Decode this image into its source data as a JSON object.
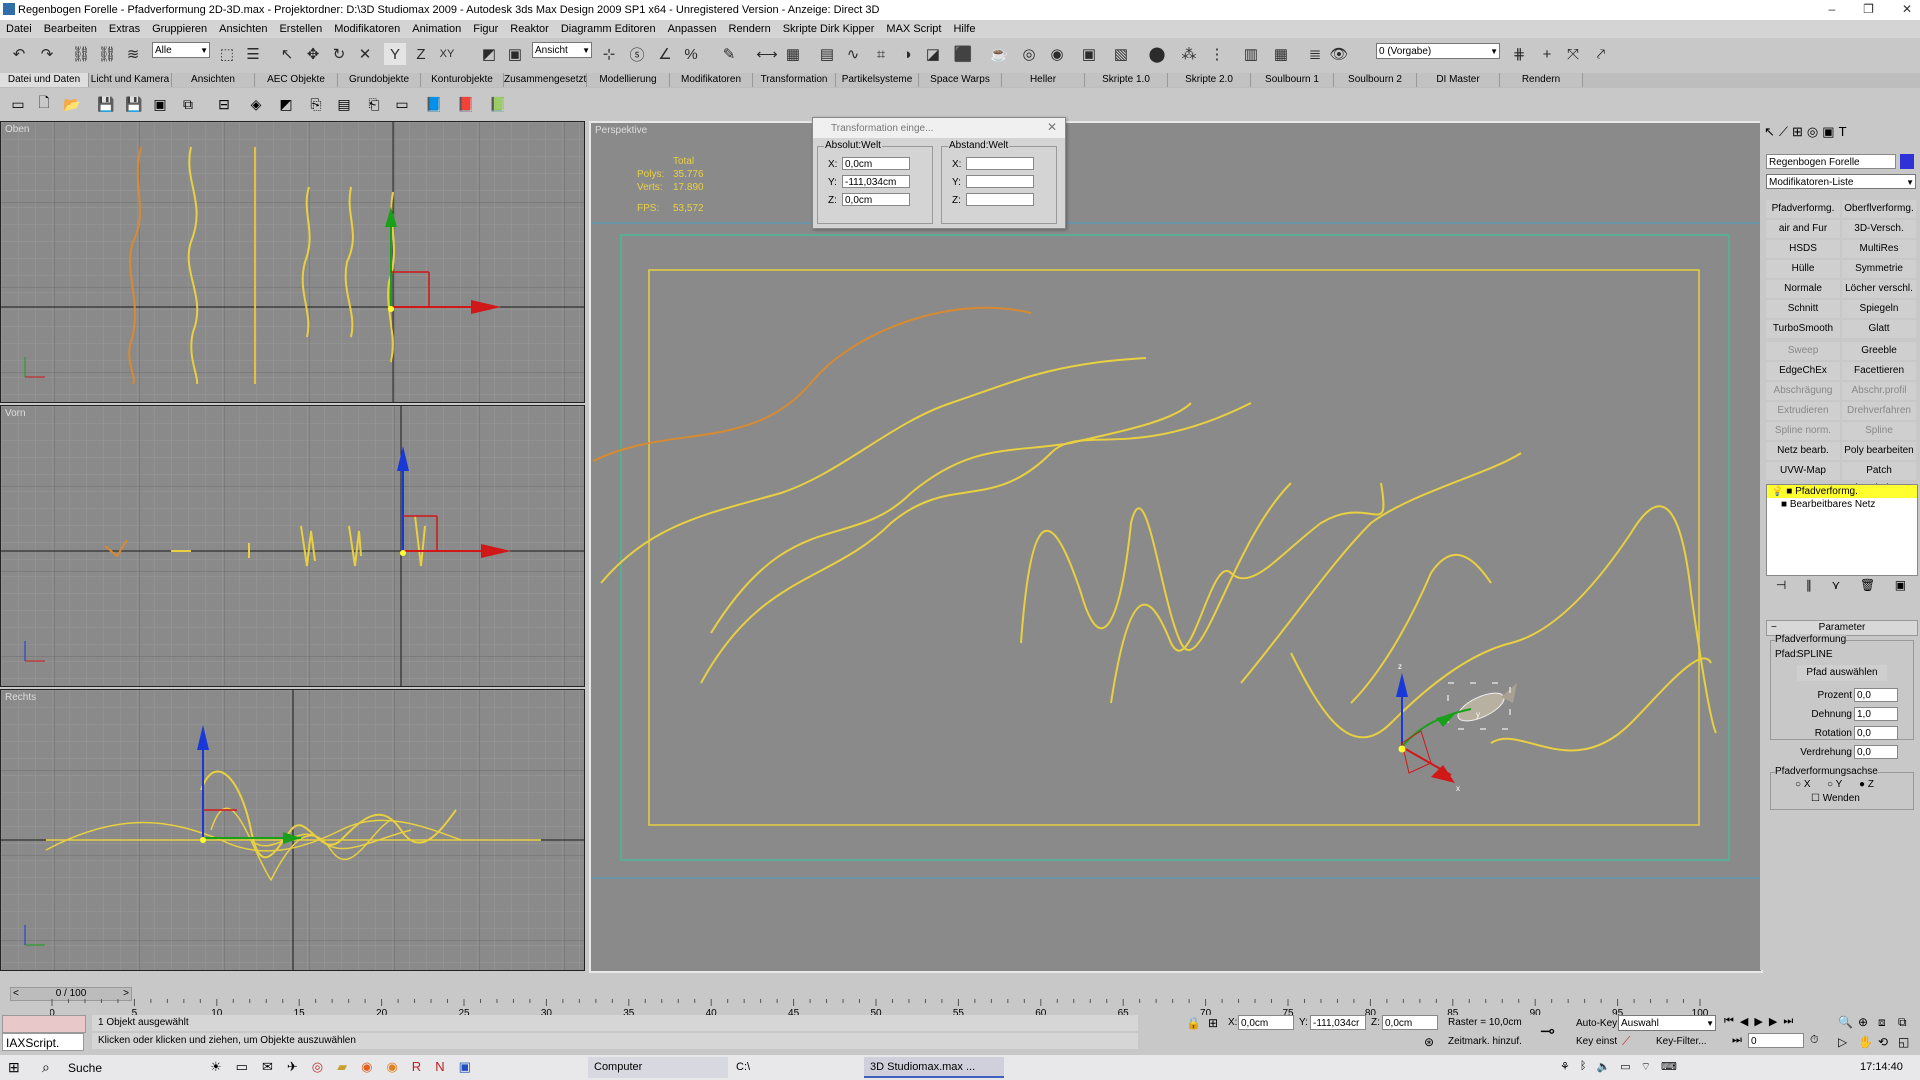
{
  "window": {
    "title": "Regenbogen Forelle - Pfadverformung 2D-3D.max     - Projektordner: D:\\3D Studiomax 2009     - Autodesk 3ds Max Design 2009 SP1  x64  - Unregistered Version     - Anzeige: Direct 3D",
    "controls": [
      "–",
      "❐",
      "✕"
    ]
  },
  "menu": [
    "Datei",
    "Bearbeiten",
    "Extras",
    "Gruppieren",
    "Ansichten",
    "Erstellen",
    "Modifikatoren",
    "Animation",
    "Figur",
    "Reaktor",
    "Diagramm Editoren",
    "Anpassen",
    "Rendern",
    "Skripte Dirk Kipper",
    "MAX Script",
    "Hilfe"
  ],
  "toolbar": {
    "selection_filter": "Alle",
    "coord_system": "Ansicht",
    "layer": "0 (Vorgabe)"
  },
  "tabs": [
    "Datei und Daten",
    "Licht und Kamera",
    "Ansichten",
    "AEC Objekte",
    "Grundobjekte",
    "Konturobjekte",
    "Zusammengesetzt",
    "Modellierung",
    "Modifikatoren",
    "Transformation",
    "Partikelsysteme",
    "Space Warps",
    "Heller",
    "Skripte 1.0",
    "Skripte 2.0",
    "Soulbourn 1",
    "Soulbourn 2",
    "DI Master",
    "Rendern"
  ],
  "viewports": {
    "top": "Oben",
    "front": "Vorn",
    "right": "Rechts",
    "perspective": "Perspektive"
  },
  "stats": {
    "total_label": "Total",
    "polys_label": "Polys:",
    "polys_value": "35.776",
    "verts_label": "Verts:",
    "verts_value": "17.890",
    "fps_label": "FPS:",
    "fps_value": "53,572"
  },
  "transform_dialog": {
    "title": "Transformation einge...",
    "absolute_group": "Absolut:Welt",
    "offset_group": "Abstand:Welt",
    "x_label": "X:",
    "y_label": "Y:",
    "z_label": "Z:",
    "abs_x": "0,0cm",
    "abs_y": "-111,034cm",
    "abs_z": "0,0cm"
  },
  "command_panel": {
    "object_name": "Regenbogen Forelle",
    "object_color": "#3030d8",
    "modifier_list": "Modifikatoren-Liste",
    "buttons": [
      {
        "label": "Pfadverformg.",
        "enabled": true
      },
      {
        "label": "Oberflverformg.",
        "enabled": true
      },
      {
        "label": "air and Fur (WKN",
        "enabled": true
      },
      {
        "label": "3D-Versch.",
        "enabled": true
      },
      {
        "label": "HSDS",
        "enabled": true
      },
      {
        "label": "MultiRes",
        "enabled": true
      },
      {
        "label": "Hülle",
        "enabled": true
      },
      {
        "label": "Symmetrie",
        "enabled": true
      },
      {
        "label": "Normale",
        "enabled": true
      },
      {
        "label": "Löcher verschl.",
        "enabled": true
      },
      {
        "label": "Schnitt",
        "enabled": true
      },
      {
        "label": "Spiegeln",
        "enabled": true
      },
      {
        "label": "TurboSmooth",
        "enabled": true
      },
      {
        "label": "Glatt",
        "enabled": true
      },
      {
        "label": "Sweep",
        "enabled": false
      },
      {
        "label": "Greeble",
        "enabled": true
      },
      {
        "label": "EdgeChEx",
        "enabled": true
      },
      {
        "label": "Facettieren",
        "enabled": true
      },
      {
        "label": "Abschrägung",
        "enabled": false
      },
      {
        "label": "Abschr.profil",
        "enabled": false
      },
      {
        "label": "Extrudieren",
        "enabled": false
      },
      {
        "label": "Drehverfahren",
        "enabled": false
      },
      {
        "label": "Spline norm.",
        "enabled": false
      },
      {
        "label": "Spline bearbeiten",
        "enabled": false
      },
      {
        "label": "Netz bearb.",
        "enabled": true
      },
      {
        "label": "Poly bearbeiten",
        "enabled": true
      },
      {
        "label": "UVW-Map",
        "enabled": true
      },
      {
        "label": "Patch bearbeiten",
        "enabled": true
      }
    ],
    "stack": [
      "Pfadverformg.",
      "Bearbeitbares Netz"
    ],
    "rollout_title": "Parameter",
    "group1": "Pfadverformung",
    "path_label": "Pfad:",
    "path_value": "SPLINE",
    "pick_path": "Pfad auswählen",
    "params": [
      {
        "label": "Prozent",
        "value": "0,0"
      },
      {
        "label": "Dehnung",
        "value": "1,0"
      },
      {
        "label": "Rotation",
        "value": "0,0"
      },
      {
        "label": "Verdrehung",
        "value": "0,0"
      }
    ],
    "axis_group": "Pfadverformungsachse",
    "axis_x": "X",
    "axis_y": "Y",
    "axis_z": "Z",
    "flip": "Wenden"
  },
  "timeline": {
    "frame": "0 / 100",
    "ticks": [
      "0",
      "5",
      "10",
      "15",
      "20",
      "25",
      "30",
      "35",
      "40",
      "45",
      "50",
      "55",
      "60",
      "65",
      "70",
      "75",
      "80",
      "85",
      "90",
      "95",
      "100"
    ]
  },
  "status": {
    "selected": "1 Objekt ausgewählt",
    "prompt": "Klicken oder klicken und ziehen, um Objekte auszuwählen",
    "maxscript": "IAXScript.",
    "x_label": "X:",
    "y_label": "Y:",
    "z_label": "Z:",
    "x": "0,0cm",
    "y": "-111,034cr",
    "z": "0,0cm",
    "grid": "Raster = 10,0cm",
    "timetag": "Zeitmark. hinzuf.",
    "autokey": "Auto-Key",
    "setkey": "Key einst",
    "selection": "Auswahl",
    "keyfilter": "Key-Filter...",
    "frame_field": "0"
  },
  "taskbar": {
    "search": "Suche",
    "items": [
      "Computer",
      "C:\\",
      "3D Studiomax.max"
    ],
    "more": "...",
    "clock": "17:14:40"
  }
}
